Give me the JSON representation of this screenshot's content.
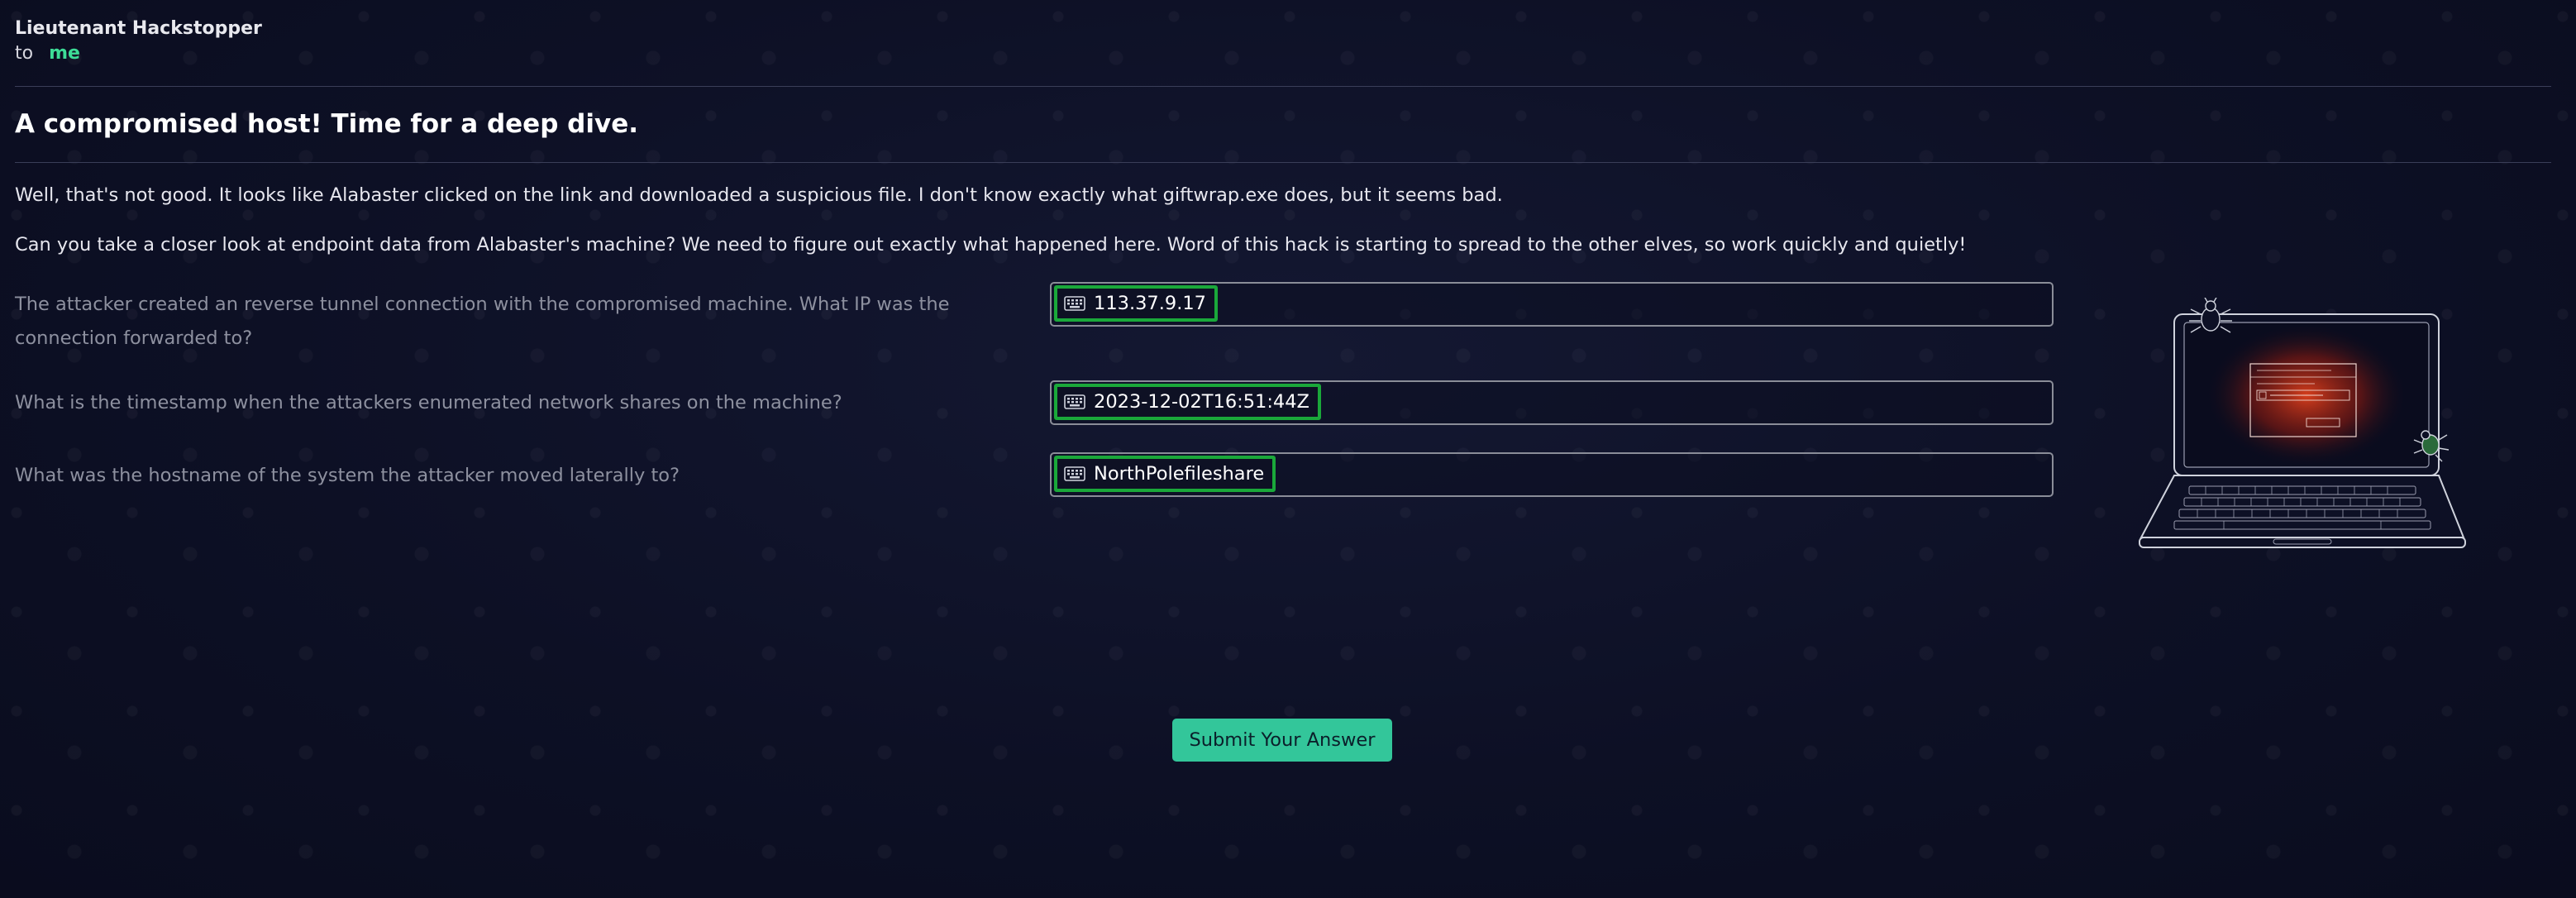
{
  "email": {
    "sender": "Lieutenant Hackstopper",
    "to_label": "to",
    "recipient": "me",
    "subject": "A compromised host! Time for a deep dive.",
    "paragraphs": [
      "Well, that's not good. It looks like Alabaster clicked on the link and downloaded a suspicious file. I don't know exactly what giftwrap.exe does, but it seems bad.",
      "Can you take a closer look at endpoint data from Alabaster's machine? We need to figure out exactly what happened here. Word of this hack is starting to spread to the other elves, so work quickly and quietly!"
    ]
  },
  "questions": [
    {
      "label": "The attacker created an reverse tunnel connection with the compromised machine. What IP was the connection forwarded to?",
      "answer": "113.37.9.17"
    },
    {
      "label": "What is the timestamp when the attackers enumerated network shares on the machine?",
      "answer": "2023-12-02T16:51:44Z"
    },
    {
      "label": "What was the hostname of the system the attacker moved laterally to?",
      "answer": "NorthPolefileshare"
    }
  ],
  "submit_label": "Submit Your Answer",
  "icons": {
    "answer_chip": "keyboard-icon",
    "illustration": "laptop-illustration",
    "bugs": "bug-icon"
  },
  "colors": {
    "accent": "#3ddc97",
    "submit_bg": "#33c69a",
    "chip_border": "#1aa83a",
    "background": "#0d1025"
  }
}
